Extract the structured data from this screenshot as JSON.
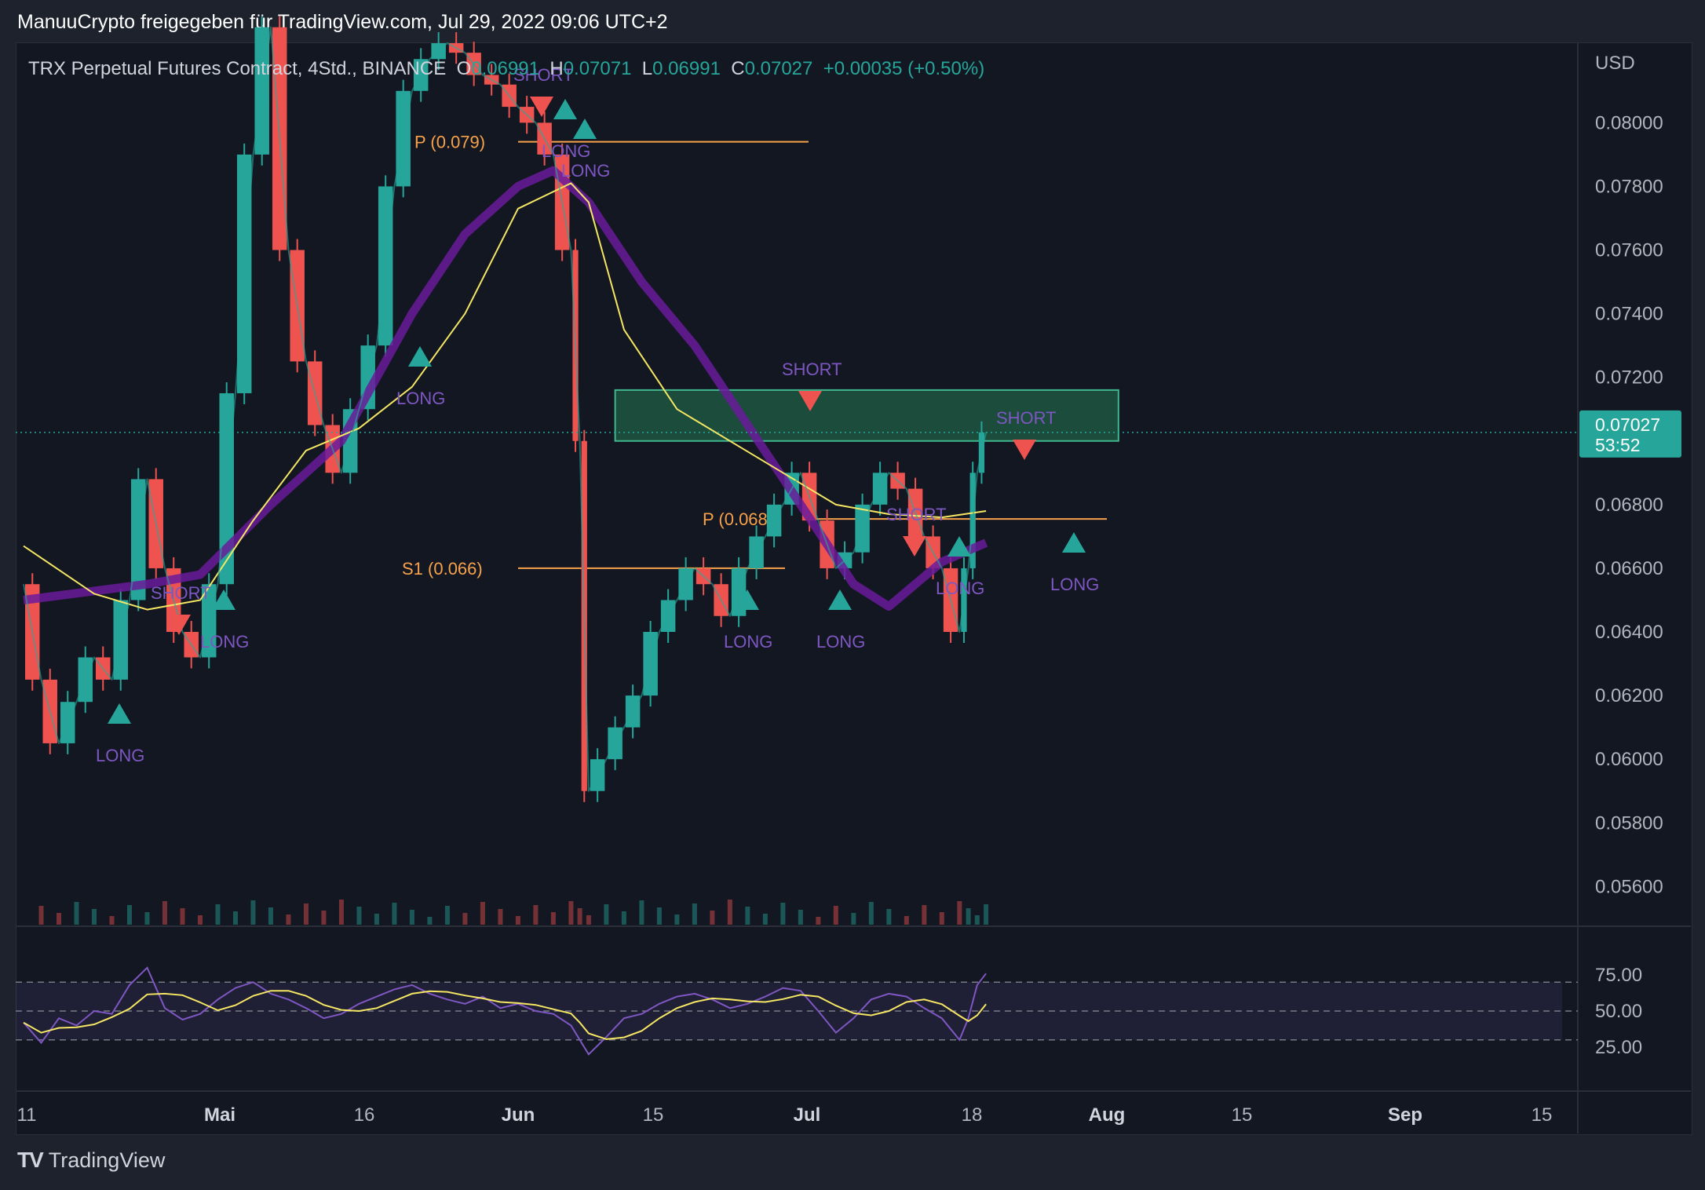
{
  "header": {
    "shared_by": "ManuuCrypto freigegeben für TradingView.com, Jul 29, 2022 09:06 UTC+2"
  },
  "legend": {
    "symbol": "TRX Perpetual Futures Contract, 4Std., BINANCE",
    "open_label": "O",
    "open": "0.06991",
    "high_label": "H",
    "high": "0.07071",
    "low_label": "L",
    "low": "0.06991",
    "close_label": "C",
    "close": "0.07027",
    "change": "+0.00035 (+0.50%)"
  },
  "price_axis": {
    "currency": "USD",
    "ticks": [
      "0.08000",
      "0.07800",
      "0.07600",
      "0.07400",
      "0.07200",
      "0.06800",
      "0.06600",
      "0.06400",
      "0.06200",
      "0.06000",
      "0.05800",
      "0.05600"
    ],
    "last_price": "0.07027",
    "countdown": "53:52"
  },
  "rsi_axis": {
    "ticks": [
      "75.00",
      "50.00",
      "25.00"
    ]
  },
  "time_axis": {
    "ticks": [
      "11",
      "Mai",
      "16",
      "Jun",
      "15",
      "Jul",
      "18",
      "Aug",
      "15",
      "Sep",
      "15"
    ]
  },
  "pivots": [
    {
      "label": "P (0.079)",
      "price": 0.0794
    },
    {
      "label": "P (0.068)",
      "price": 0.06755
    },
    {
      "label": "S1 (0.066)",
      "price": 0.066
    }
  ],
  "signals": [
    {
      "label": "LONG",
      "kind": "long"
    },
    {
      "label": "SHORT",
      "kind": "short"
    },
    {
      "label": "LONG",
      "kind": "long"
    },
    {
      "label": "SHORT",
      "kind": "short"
    },
    {
      "label": "LONG",
      "kind": "long"
    },
    {
      "label": "LONG",
      "kind": "long"
    },
    {
      "label": "LONG",
      "kind": "long"
    },
    {
      "label": "LONG",
      "kind": "long"
    },
    {
      "label": "SHORT",
      "kind": "short"
    },
    {
      "label": "LONG",
      "kind": "long"
    },
    {
      "label": "SHORT",
      "kind": "short"
    },
    {
      "label": "LONG",
      "kind": "long"
    },
    {
      "label": "SHORT",
      "kind": "short"
    },
    {
      "label": "LONG",
      "kind": "long"
    }
  ],
  "footer": {
    "brand": "TradingView"
  },
  "colors": {
    "up": "#26a69a",
    "down": "#ef5350",
    "ma_fast": "#f5e663",
    "ma_slow": "#6a1b9a",
    "pivot": "#f7a24a",
    "signal_text": "#7e57c2",
    "zone": "#1f5f45",
    "rsi": "#7e57c2"
  },
  "chart_data": {
    "type": "line",
    "title": "TRX Perpetual Futures Contract, 4Std., BINANCE",
    "ylabel": "USD",
    "ylim": [
      0.0548,
      0.0825
    ],
    "x_ticks": [
      "11",
      "Mai",
      "16",
      "Jun",
      "15",
      "Jul",
      "18",
      "Aug",
      "15",
      "Sep",
      "15"
    ],
    "series": [
      {
        "name": "close",
        "points": [
          [
            "Apr 11",
            0.0655
          ],
          [
            "Apr 13",
            0.0625
          ],
          [
            "Apr 15",
            0.0605
          ],
          [
            "Apr 17",
            0.0618
          ],
          [
            "Apr 19",
            0.0632
          ],
          [
            "Apr 21",
            0.0625
          ],
          [
            "Apr 23",
            0.065
          ],
          [
            "Apr 25",
            0.0688
          ],
          [
            "Apr 27",
            0.066
          ],
          [
            "Apr 29",
            0.064
          ],
          [
            "May 1",
            0.0632
          ],
          [
            "May 3",
            0.0655
          ],
          [
            "May 5",
            0.0715
          ],
          [
            "May 7",
            0.079
          ],
          [
            "May 9",
            0.083
          ],
          [
            "May 11",
            0.076
          ],
          [
            "May 13",
            0.0725
          ],
          [
            "May 15",
            0.0705
          ],
          [
            "May 17",
            0.069
          ],
          [
            "May 19",
            0.071
          ],
          [
            "May 21",
            0.073
          ],
          [
            "May 23",
            0.078
          ],
          [
            "May 25",
            0.081
          ],
          [
            "May 27",
            0.082
          ],
          [
            "May 29",
            0.0825
          ],
          [
            "May 31",
            0.0822
          ],
          [
            "Jun 2",
            0.0815
          ],
          [
            "Jun 4",
            0.0812
          ],
          [
            "Jun 6",
            0.0805
          ],
          [
            "Jun 8",
            0.08
          ],
          [
            "Jun 10",
            0.079
          ],
          [
            "Jun 12",
            0.076
          ],
          [
            "Jun 13",
            0.07
          ],
          [
            "Jun 14",
            0.059
          ],
          [
            "Jun 16",
            0.06
          ],
          [
            "Jun 18",
            0.061
          ],
          [
            "Jun 20",
            0.062
          ],
          [
            "Jun 22",
            0.064
          ],
          [
            "Jun 24",
            0.065
          ],
          [
            "Jun 26",
            0.066
          ],
          [
            "Jun 28",
            0.0655
          ],
          [
            "Jun 30",
            0.0645
          ],
          [
            "Jul 2",
            0.066
          ],
          [
            "Jul 4",
            0.067
          ],
          [
            "Jul 6",
            0.068
          ],
          [
            "Jul 8",
            0.069
          ],
          [
            "Jul 10",
            0.0675
          ],
          [
            "Jul 12",
            0.066
          ],
          [
            "Jul 14",
            0.0665
          ],
          [
            "Jul 16",
            0.068
          ],
          [
            "Jul 18",
            0.069
          ],
          [
            "Jul 20",
            0.0685
          ],
          [
            "Jul 22",
            0.067
          ],
          [
            "Jul 24",
            0.066
          ],
          [
            "Jul 26",
            0.064
          ],
          [
            "Jul 27",
            0.066
          ],
          [
            "Jul 28",
            0.069
          ],
          [
            "Jul 29",
            0.07027
          ]
        ]
      },
      {
        "name": "ma_fast",
        "points": [
          [
            "Apr 11",
            0.0667
          ],
          [
            "Apr 19",
            0.0652
          ],
          [
            "Apr 25",
            0.0647
          ],
          [
            "May 1",
            0.065
          ],
          [
            "May 7",
            0.0675
          ],
          [
            "May 13",
            0.0697
          ],
          [
            "May 19",
            0.0704
          ],
          [
            "May 25",
            0.0717
          ],
          [
            "May 31",
            0.074
          ],
          [
            "Jun 6",
            0.0773
          ],
          [
            "Jun 12",
            0.0781
          ],
          [
            "Jun 14",
            0.0775
          ],
          [
            "Jun 18",
            0.0735
          ],
          [
            "Jun 24",
            0.071
          ],
          [
            "Jun 30",
            0.07
          ],
          [
            "Jul 6",
            0.069
          ],
          [
            "Jul 12",
            0.068
          ],
          [
            "Jul 18",
            0.0677
          ],
          [
            "Jul 24",
            0.0676
          ],
          [
            "Jul 29",
            0.0678
          ]
        ]
      },
      {
        "name": "ma_slow",
        "points": [
          [
            "Apr 11",
            0.065
          ],
          [
            "Apr 25",
            0.0655
          ],
          [
            "May 1",
            0.0658
          ],
          [
            "May 9",
            0.068
          ],
          [
            "May 17",
            0.07
          ],
          [
            "May 25",
            0.074
          ],
          [
            "May 31",
            0.0765
          ],
          [
            "Jun 6",
            0.078
          ],
          [
            "Jun 10",
            0.0785
          ],
          [
            "Jun 14",
            0.0775
          ],
          [
            "Jun 20",
            0.075
          ],
          [
            "Jun 26",
            0.073
          ],
          [
            "Jul 2",
            0.0705
          ],
          [
            "Jul 8",
            0.068
          ],
          [
            "Jul 14",
            0.0655
          ],
          [
            "Jul 18",
            0.0648
          ],
          [
            "Jul 24",
            0.0662
          ],
          [
            "Jul 29",
            0.0668
          ]
        ]
      }
    ],
    "zone": {
      "from": "Jun 17",
      "to": "Aug 13",
      "low": 0.07,
      "high": 0.0716
    },
    "rsi": {
      "ylim": [
        0,
        100
      ],
      "levels": [
        70,
        50,
        30
      ],
      "points": [
        [
          "Apr 11",
          42
        ],
        [
          "Apr 13",
          28
        ],
        [
          "Apr 15",
          45
        ],
        [
          "Apr 17",
          40
        ],
        [
          "Apr 19",
          50
        ],
        [
          "Apr 21",
          48
        ],
        [
          "Apr 23",
          68
        ],
        [
          "Apr 25",
          80
        ],
        [
          "Apr 27",
          52
        ],
        [
          "Apr 29",
          44
        ],
        [
          "May 1",
          48
        ],
        [
          "May 3",
          58
        ],
        [
          "May 5",
          66
        ],
        [
          "May 7",
          70
        ],
        [
          "May 9",
          62
        ],
        [
          "May 11",
          58
        ],
        [
          "May 13",
          52
        ],
        [
          "May 15",
          45
        ],
        [
          "May 17",
          48
        ],
        [
          "May 19",
          55
        ],
        [
          "May 21",
          60
        ],
        [
          "May 23",
          65
        ],
        [
          "May 25",
          68
        ],
        [
          "May 27",
          62
        ],
        [
          "May 29",
          58
        ],
        [
          "May 31",
          55
        ],
        [
          "Jun 2",
          60
        ],
        [
          "Jun 4",
          52
        ],
        [
          "Jun 6",
          55
        ],
        [
          "Jun 8",
          50
        ],
        [
          "Jun 10",
          48
        ],
        [
          "Jun 12",
          40
        ],
        [
          "Jun 13",
          30
        ],
        [
          "Jun 14",
          20
        ],
        [
          "Jun 16",
          32
        ],
        [
          "Jun 18",
          45
        ],
        [
          "Jun 20",
          48
        ],
        [
          "Jun 22",
          55
        ],
        [
          "Jun 24",
          60
        ],
        [
          "Jun 26",
          62
        ],
        [
          "Jun 28",
          58
        ],
        [
          "Jun 30",
          52
        ],
        [
          "Jul 2",
          55
        ],
        [
          "Jul 4",
          60
        ],
        [
          "Jul 6",
          66
        ],
        [
          "Jul 8",
          64
        ],
        [
          "Jul 10",
          50
        ],
        [
          "Jul 12",
          35
        ],
        [
          "Jul 14",
          45
        ],
        [
          "Jul 16",
          58
        ],
        [
          "Jul 18",
          62
        ],
        [
          "Jul 20",
          60
        ],
        [
          "Jul 22",
          52
        ],
        [
          "Jul 24",
          45
        ],
        [
          "Jul 26",
          30
        ],
        [
          "Jul 27",
          45
        ],
        [
          "Jul 28",
          68
        ],
        [
          "Jul 29",
          76
        ]
      ]
    }
  }
}
